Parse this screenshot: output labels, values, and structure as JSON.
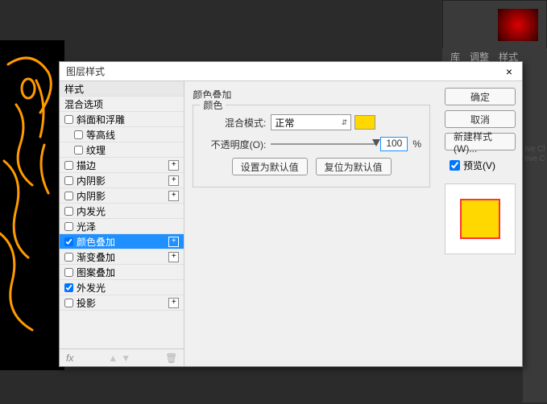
{
  "panel_tabs": {
    "t1": "库",
    "t2": "调整",
    "t3": "样式"
  },
  "dialog": {
    "title": "图层样式",
    "styles_header": "样式",
    "blend_options": "混合选项",
    "items": {
      "bevel": "斜面和浮雕",
      "contour": "等高线",
      "texture": "纹理",
      "stroke": "描边",
      "inner_shadow1": "内阴影",
      "inner_shadow2": "内阴影",
      "inner_glow": "内发光",
      "satin": "光泽",
      "color_overlay": "颜色叠加",
      "gradient_overlay": "渐变叠加",
      "pattern_overlay": "图案叠加",
      "outer_glow": "外发光",
      "drop_shadow": "投影"
    },
    "fx_label": "fx"
  },
  "options": {
    "section_title": "颜色叠加",
    "legend": "颜色",
    "blend_mode_label": "混合模式:",
    "blend_mode_value": "正常",
    "opacity_label": "不透明度(O):",
    "opacity_value": "100",
    "opacity_unit": "%",
    "btn_default": "设置为默认值",
    "btn_reset": "复位为默认值"
  },
  "actions": {
    "ok": "确定",
    "cancel": "取消",
    "new_style": "新建样式(W)...",
    "preview": "预览(V)"
  }
}
